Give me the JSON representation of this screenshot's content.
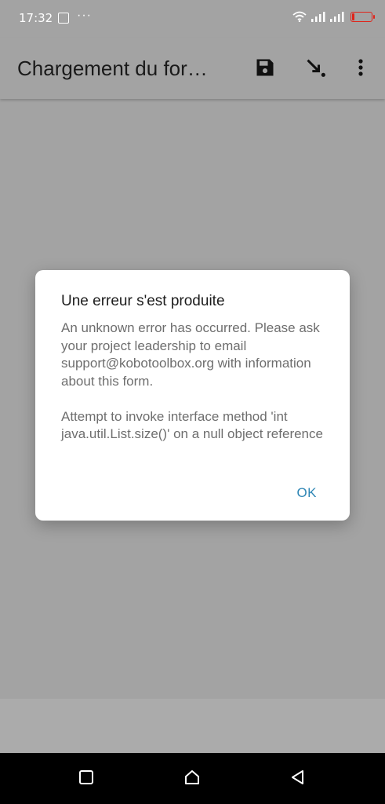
{
  "status_bar": {
    "time": "17:32",
    "more_indicator": "···",
    "icons": [
      "image-icon",
      "wifi-icon",
      "signal-icon",
      "signal-icon",
      "battery-icon"
    ],
    "battery_color": "#e0241a"
  },
  "app_bar": {
    "title": "Chargement du for…",
    "actions": [
      "save-icon",
      "go-to-icon",
      "overflow-menu-icon"
    ]
  },
  "dialog": {
    "title": "Une erreur s'est produite",
    "message": "An unknown error has occurred. Please ask your project leadership to email support@kobotoolbox.org with information about this form.\n\nAttempt to invoke interface method 'int java.util.List.size()' on a null object reference",
    "ok_label": "OK",
    "accent_color": "#2e86b5"
  },
  "nav_bar": {
    "buttons": [
      "recents-icon",
      "home-icon",
      "back-icon"
    ]
  }
}
